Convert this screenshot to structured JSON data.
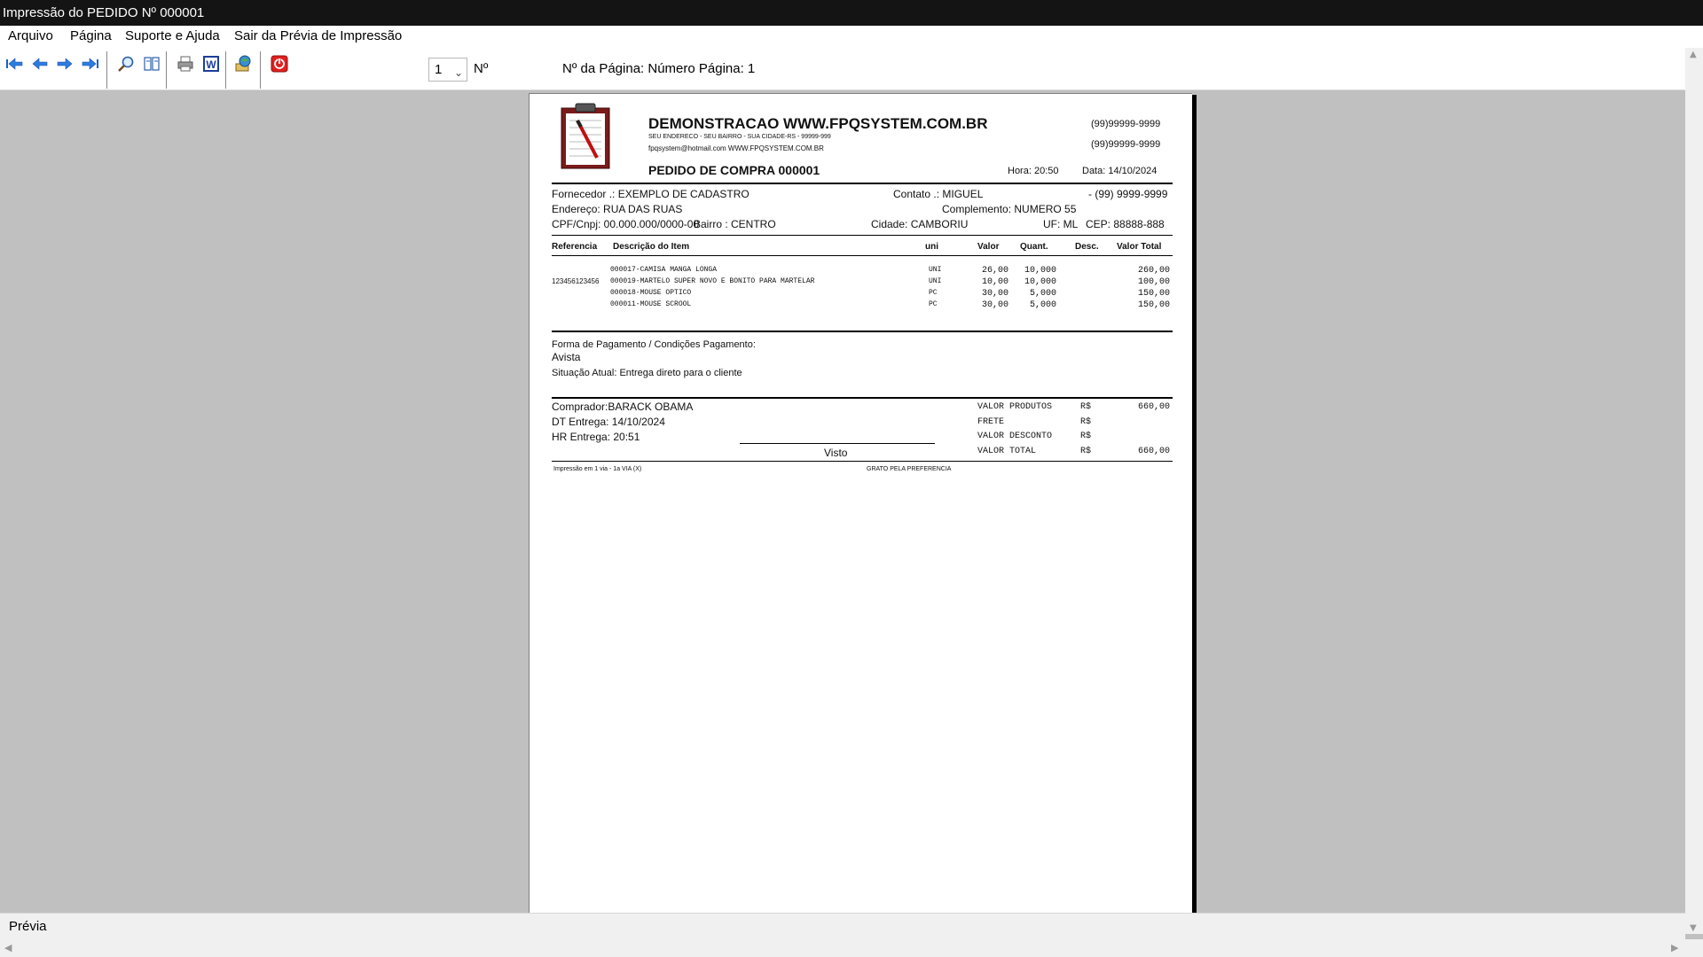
{
  "window": {
    "title": "Impressão do PEDIDO Nº 000001"
  },
  "menu": {
    "arquivo": "Arquivo",
    "pagina": "Página",
    "suporte": "Suporte e Ajuda",
    "sair": "Sair da Prévia de Impressão"
  },
  "toolbar": {
    "page_value": "1",
    "n_label": "Nº",
    "page_info": "Nº da Página: Número Página: 1"
  },
  "status": {
    "text": "Prévia"
  },
  "report": {
    "company": "DEMONSTRACAO WWW.FPQSYSTEM.COM.BR",
    "address": "SEU ENDERECO - SEU BAIRRO - SUA CIDADE-RS - 99999-999",
    "contact": "fpqsystem@hotmail.com  WWW.FPQSYSTEM.COM.BR",
    "phone1": "(99)99999-9999",
    "phone2": "(99)99999-9999",
    "order_title": "PEDIDO DE COMPRA 000001",
    "hora": "Hora: 20:50",
    "data": "Data: 14/10/2024",
    "fornecedor": "Fornecedor .: EXEMPLO DE CADASTRO",
    "contato": "Contato .: MIGUEL",
    "fone": "- (99) 9999-9999",
    "endereco": "Endereço: RUA DAS RUAS",
    "complemento": "Complemento: NUMERO 55",
    "cpf": "CPF/Cnpj: 00.000.000/0000-00",
    "bairro": "Bairro : CENTRO",
    "cidade": "Cidade: CAMBORIU",
    "uf": "UF: ML",
    "cep": "CEP: 88888-888",
    "headers": {
      "ref": "Referencia",
      "desc": "Descrição do Item",
      "uni": "uni",
      "valor": "Valor",
      "quant": "Quant.",
      "desconto": "Desc.",
      "total": "Valor Total"
    },
    "items": [
      {
        "ref": "",
        "desc": "000017-CAMISA MANGA LONGA",
        "uni": "UNI",
        "valor": "26,00",
        "quant": "10,000",
        "total": "260,00"
      },
      {
        "ref": "123456123456",
        "desc": "000019-MARTELO SUPER NOVO E BONITO PARA MARTELAR",
        "uni": "UNI",
        "valor": "10,00",
        "quant": "10,000",
        "total": "100,00"
      },
      {
        "ref": "",
        "desc": "000018-MOUSE OPTICO",
        "uni": "PC",
        "valor": "30,00",
        "quant": "5,000",
        "total": "150,00"
      },
      {
        "ref": "",
        "desc": "000011-MOUSE SCROOL",
        "uni": "PC",
        "valor": "30,00",
        "quant": "5,000",
        "total": "150,00"
      }
    ],
    "pagamento_label": "Forma de Pagamento / Condições Pagamento:",
    "pagamento_value": "Avista",
    "situacao": "Situação Atual: Entrega direto para o cliente",
    "comprador": "Comprador:BARACK OBAMA",
    "dt_entrega": "DT Entrega: 14/10/2024",
    "hr_entrega": "HR Entrega: 20:51",
    "visto": "Visto",
    "totals": {
      "produtos_label": "VALOR PRODUTOS",
      "frete_label": "FRETE",
      "desconto_label": "VALOR DESCONTO",
      "total_label": "VALOR TOTAL",
      "currency": "R$",
      "produtos_value": "660,00",
      "total_value": "660,00"
    },
    "footer_left": "Impressão em 1 via - 1a VIA (X)",
    "footer_center": "GRATO PELA PREFERENCIA"
  }
}
